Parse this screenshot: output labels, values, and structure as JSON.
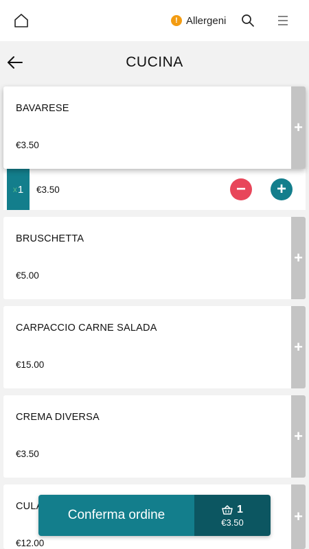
{
  "topbar": {
    "home_icon": "home-icon",
    "allergen_label": "Allergeni",
    "allergen_icon": "!",
    "search_icon": "search-icon",
    "menu_icon": "menu-icon"
  },
  "header": {
    "title": "CUCINA",
    "back_icon": "arrow-left-icon"
  },
  "products": [
    {
      "name": "BAVARESE",
      "price": "€3.50"
    },
    {
      "name": "BRUSCHETTA",
      "price": "€5.00"
    },
    {
      "name": "CARPACCIO CARNE SALADA",
      "price": "€15.00"
    },
    {
      "name": "CREMA DIVERSA",
      "price": "€3.50"
    },
    {
      "name": "CULA",
      "price": "€12.00"
    }
  ],
  "add_symbol": "+",
  "selected_item": {
    "qty_prefix": "x",
    "quantity": "1",
    "price": "€3.50",
    "minus_symbol": "−",
    "plus_symbol": "+"
  },
  "cart": {
    "confirm_label": "Conferma ordine",
    "count": "1",
    "total": "€3.50"
  },
  "colors": {
    "accent": "#137e8c",
    "accent_dark": "#0c5661",
    "danger": "#e8465a",
    "warning": "#f39c12",
    "add_strip": "#c4c4c4"
  }
}
